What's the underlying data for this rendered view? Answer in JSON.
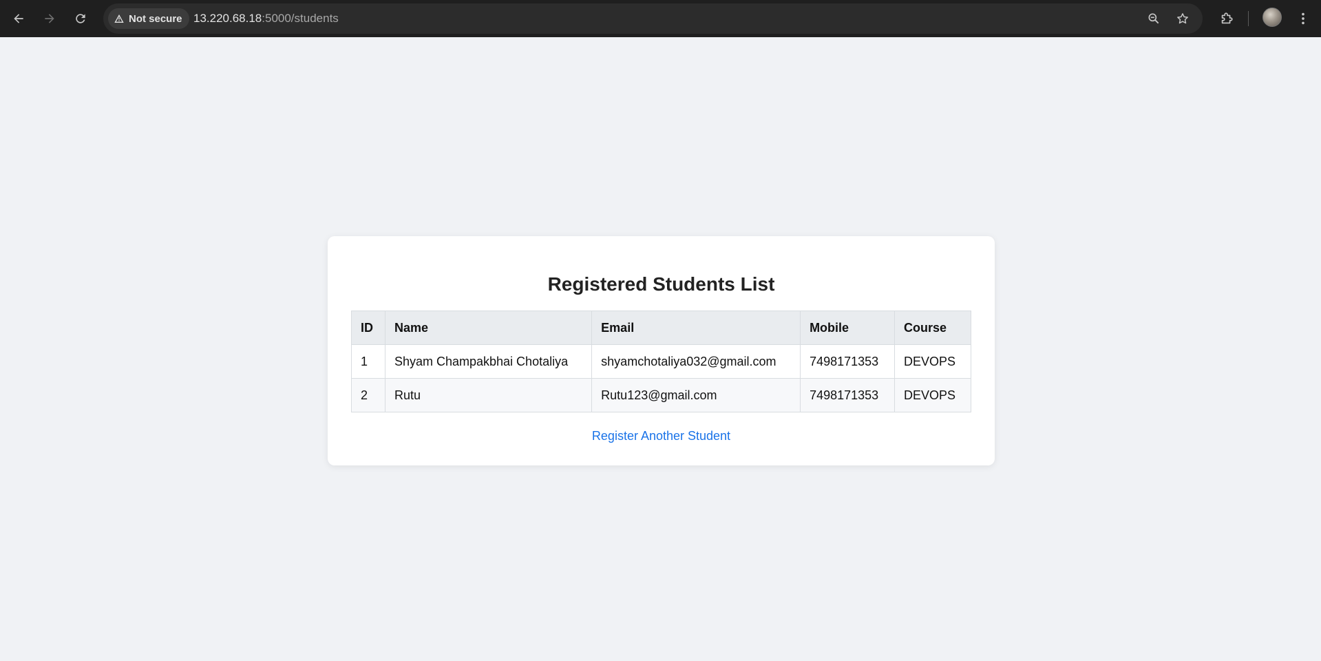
{
  "browser": {
    "security_label": "Not secure",
    "url_host": "13.220.68.18",
    "url_path": ":5000/students",
    "icons": [
      "back-icon",
      "forward-icon",
      "reload-icon",
      "warning-icon",
      "zoom-icon",
      "star-icon",
      "extensions-icon",
      "menu-icon"
    ]
  },
  "page": {
    "title": "Registered Students List",
    "table": {
      "headers": [
        "ID",
        "Name",
        "Email",
        "Mobile",
        "Course"
      ],
      "rows": [
        [
          "1",
          "Shyam Champakbhai Chotaliya",
          "shyamchotaliya032@gmail.com",
          "7498171353",
          "DEVOPS"
        ],
        [
          "2",
          "Rutu",
          "Rutu123@gmail.com",
          "7498171353",
          "DEVOPS"
        ]
      ]
    },
    "register_link": "Register Another Student"
  },
  "colors": {
    "background": "#f0f2f5",
    "link": "#1a73e8",
    "header_bg": "#e9ecef",
    "chrome": "#1f1f1f"
  }
}
